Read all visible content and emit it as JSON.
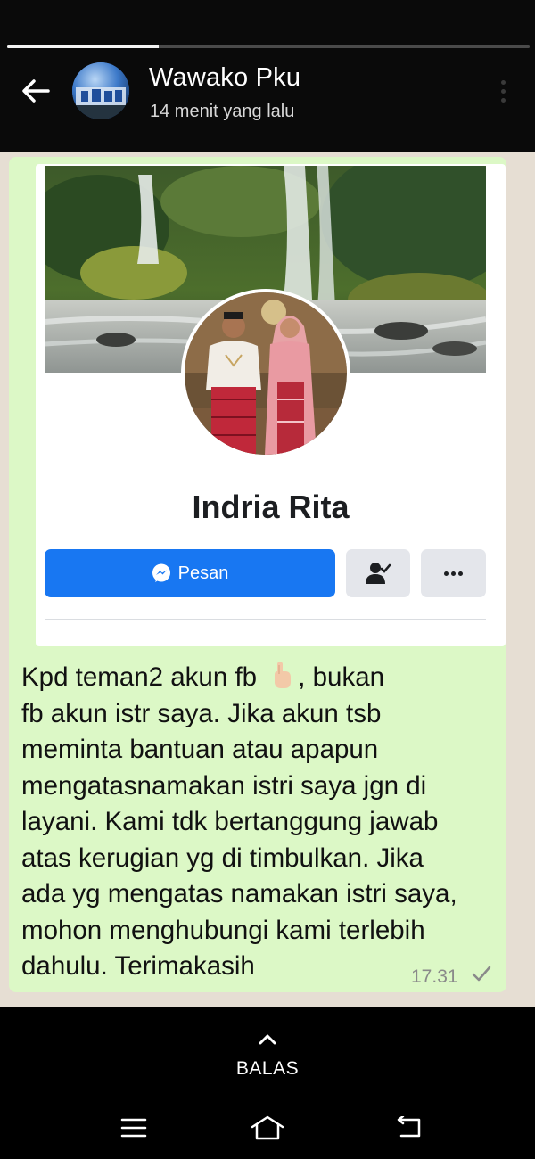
{
  "status_header": {
    "contact_name": "Wawako Pku",
    "time_ago": "14 menit yang lalu",
    "progress": 0.29
  },
  "fb_profile": {
    "name": "Indria Rita",
    "message_button_label": "Pesan"
  },
  "message": {
    "lines": [
      "Kpd teman2 akun fb",
      ", bukan",
      "fb akun istr saya. Jika akun tsb",
      "meminta bantuan atau apapun",
      "mengatasnamakan istri saya jgn di",
      "layani. Kami tdk bertanggung jawab",
      "atas kerugian yg di timbulkan. Jika",
      "ada yg mengatas namakan istri saya,",
      "mohon menghubungi kami terlebih",
      "dahulu. Terimakasih"
    ],
    "time": "17.31",
    "status_icon": "single-check-icon"
  },
  "reply": {
    "label": "BALAS"
  },
  "colors": {
    "bubble": "#dcf8c6",
    "fb_blue": "#1877f2",
    "chat_bg": "#e6ded3"
  }
}
